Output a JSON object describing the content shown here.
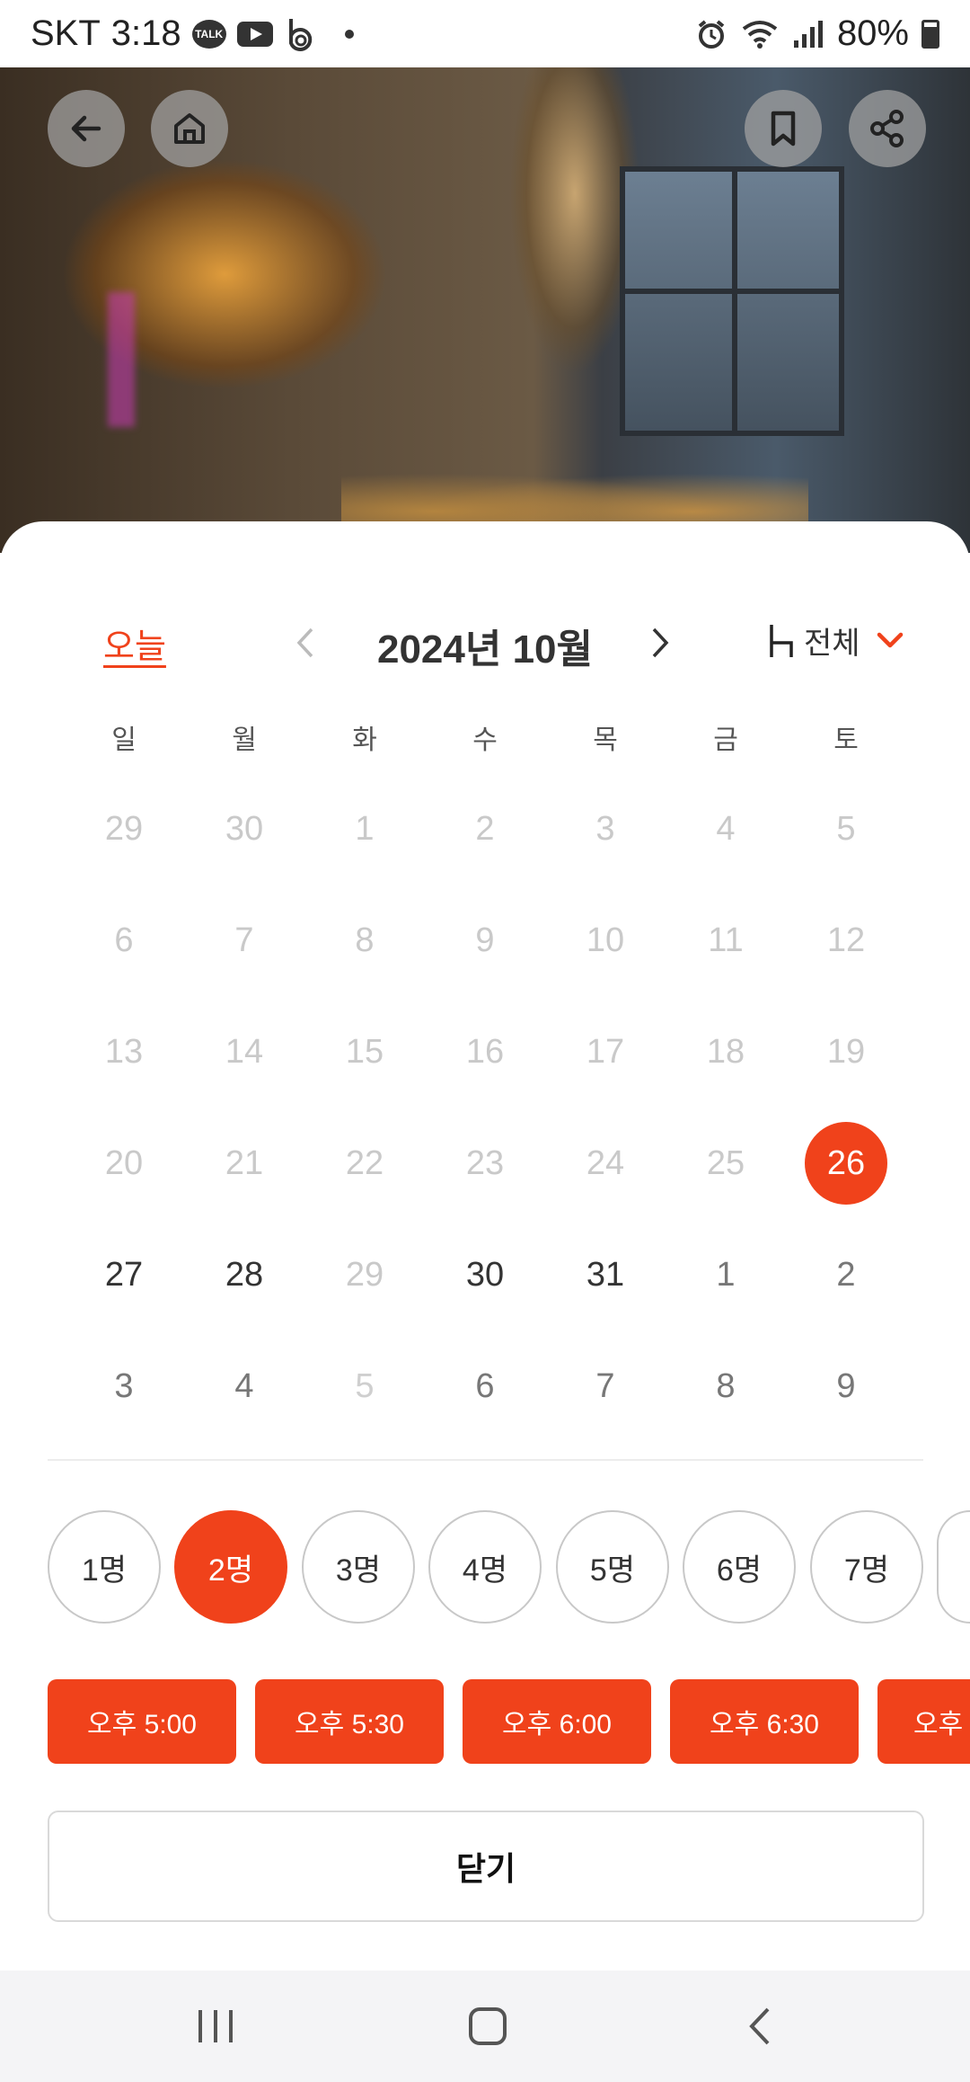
{
  "status_bar": {
    "carrier": "SKT",
    "time": "3:18",
    "notif_talk": "TALK",
    "battery": "80%"
  },
  "hero": {
    "buttons": [
      "back-icon",
      "home-icon",
      "bookmark-icon",
      "share-icon"
    ]
  },
  "calendar": {
    "today_label": "오늘",
    "month_title": "2024년  10월",
    "filter_label": "전체",
    "weekdays": [
      "일",
      "월",
      "화",
      "수",
      "목",
      "금",
      "토"
    ],
    "weeks": [
      [
        "29",
        "30",
        "1",
        "2",
        "3",
        "4",
        "5"
      ],
      [
        "6",
        "7",
        "8",
        "9",
        "10",
        "11",
        "12"
      ],
      [
        "13",
        "14",
        "15",
        "16",
        "17",
        "18",
        "19"
      ],
      [
        "20",
        "21",
        "22",
        "23",
        "24",
        "25",
        "26"
      ],
      [
        "27",
        "28",
        "29",
        "30",
        "31",
        "1",
        "2"
      ],
      [
        "3",
        "4",
        "5",
        "6",
        "7",
        "8",
        "9"
      ]
    ],
    "selected_day": "26"
  },
  "party_sizes": [
    "1명",
    "2명",
    "3명",
    "4명",
    "5명",
    "6명",
    "7명",
    ""
  ],
  "selected_party_size": "2명",
  "time_slots": [
    "오후 5:00",
    "오후 5:30",
    "오후 6:00",
    "오후 6:30",
    "오후"
  ],
  "close_label": "닫기",
  "colors": {
    "accent": "#f0421b"
  }
}
